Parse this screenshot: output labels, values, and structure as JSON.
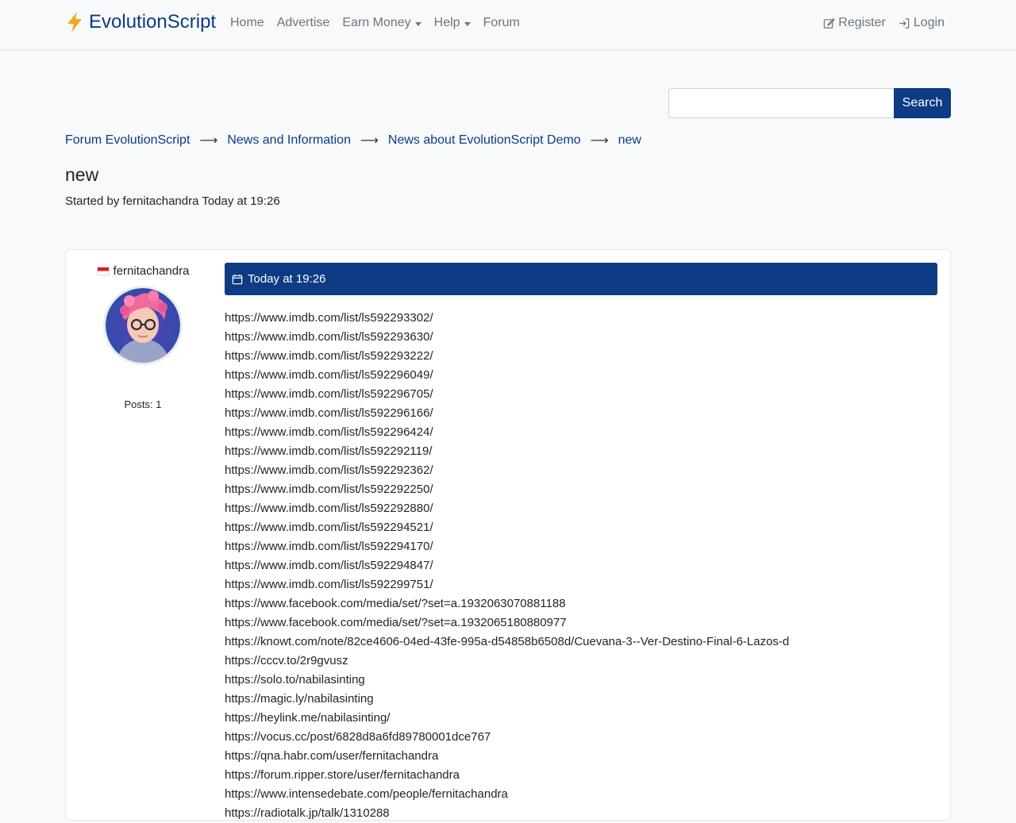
{
  "nav": {
    "brand": "EvolutionScript",
    "links": [
      "Home",
      "Advertise",
      "Earn Money",
      "Help",
      "Forum"
    ],
    "register": "Register",
    "login": "Login"
  },
  "search": {
    "button": "Search",
    "value": ""
  },
  "breadcrumb": [
    "Forum EvolutionScript",
    "News and Information",
    "News about EvolutionScript Demo",
    "new"
  ],
  "topic": {
    "title": "new",
    "started_by": "Started by fernitachandra Today at 19:26"
  },
  "post": {
    "author": "fernitachandra",
    "posts_count": "Posts: 1",
    "date": "Today at 19:26",
    "lines": [
      "https://www.imdb.com/list/ls592293302/",
      "https://www.imdb.com/list/ls592293630/",
      "https://www.imdb.com/list/ls592293222/",
      "https://www.imdb.com/list/ls592296049/",
      "https://www.imdb.com/list/ls592296705/",
      "https://www.imdb.com/list/ls592296166/",
      "https://www.imdb.com/list/ls592296424/",
      "https://www.imdb.com/list/ls592292119/",
      "https://www.imdb.com/list/ls592292362/",
      "https://www.imdb.com/list/ls592292250/",
      "https://www.imdb.com/list/ls592292880/",
      "https://www.imdb.com/list/ls592294521/",
      "https://www.imdb.com/list/ls592294170/",
      "https://www.imdb.com/list/ls592294847/",
      "https://www.imdb.com/list/ls592299751/",
      "https://www.facebook.com/media/set/?set=a.1932063070881188",
      "https://www.facebook.com/media/set/?set=a.1932065180880977",
      "https://knowt.com/note/82ce4606-04ed-43fe-995a-d54858b6508d/Cuevana-3--Ver-Destino-Final-6-Lazos-d",
      "https://cccv.to/2r9gvusz",
      "https://solo.to/nabilasinting",
      "https://magic.ly/nabilasinting",
      "https://heylink.me/nabilasinting/",
      "https://vocus.cc/post/6828d8a6fd89780001dce767",
      "https://qna.habr.com/user/fernitachandra",
      "https://forum.ripper.store/user/fernitachandra",
      "https://www.intensedebate.com/people/fernitachandra",
      "https://radiotalk.jp/talk/1310288"
    ]
  },
  "colors": {
    "primary": "#0d3b84",
    "brand_bolt": "#f5a623"
  },
  "icons": {
    "brand": "lightning-bolt-icon",
    "register": "edit-square-icon",
    "login": "sign-in-icon",
    "date": "calendar-icon",
    "flag": "indonesia-flag-icon"
  }
}
